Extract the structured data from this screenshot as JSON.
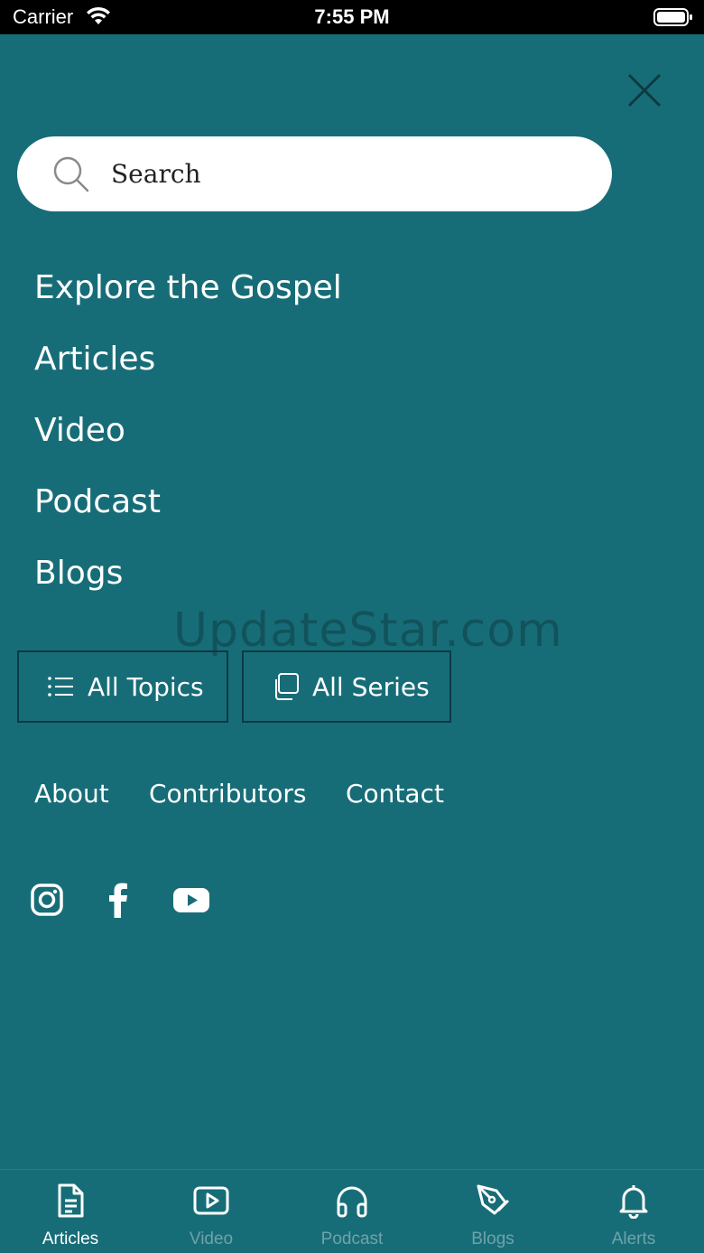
{
  "status_bar": {
    "carrier": "Carrier",
    "time": "7:55 PM"
  },
  "search": {
    "placeholder": "Search"
  },
  "nav": {
    "items": [
      {
        "label": "Explore the Gospel"
      },
      {
        "label": "Articles"
      },
      {
        "label": "Video"
      },
      {
        "label": "Podcast"
      },
      {
        "label": "Blogs"
      }
    ]
  },
  "watermark": "UpdateStar.com",
  "buttons": {
    "all_topics": "All Topics",
    "all_series": "All Series"
  },
  "footer_links": {
    "about": "About",
    "contributors": "Contributors",
    "contact": "Contact"
  },
  "social": {
    "icons": [
      "instagram-icon",
      "facebook-icon",
      "youtube-icon"
    ]
  },
  "tab_bar": {
    "tabs": [
      {
        "label": "Articles",
        "icon": "document-icon",
        "active": true
      },
      {
        "label": "Video",
        "icon": "video-play-icon",
        "active": false
      },
      {
        "label": "Podcast",
        "icon": "headphones-icon",
        "active": false
      },
      {
        "label": "Blogs",
        "icon": "pen-nib-icon",
        "active": false
      },
      {
        "label": "Alerts",
        "icon": "bell-icon",
        "active": false
      }
    ]
  },
  "colors": {
    "background": "#176d77",
    "button_border": "#0d3a42",
    "tab_inactive": "#6fa3aa",
    "tab_active": "#ffffff"
  }
}
